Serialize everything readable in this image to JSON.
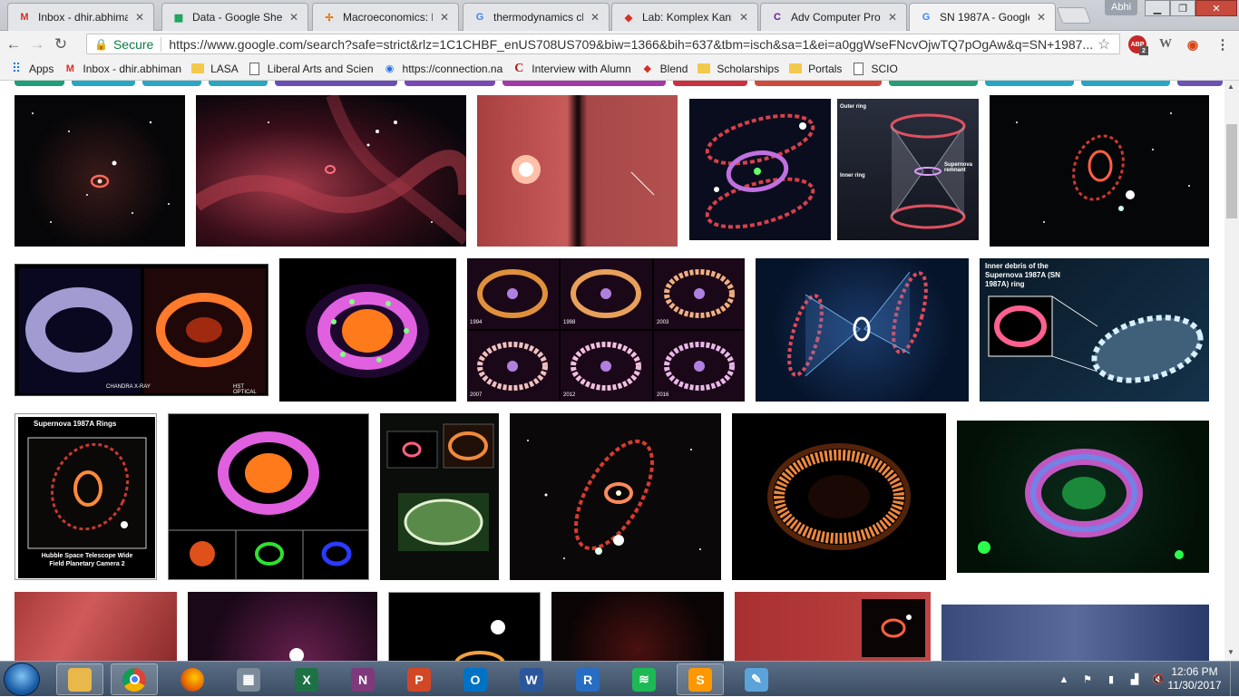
{
  "browser": {
    "tabs": [
      {
        "title": "Inbox - dhir.abhima",
        "icon": "gmail-icon",
        "icon_color": "#d93025",
        "glyph": "M"
      },
      {
        "title": "Data - Google Shee",
        "icon": "sheets-icon",
        "icon_color": "#0f9d58",
        "glyph": "▦"
      },
      {
        "title": "Macroeconomics: P",
        "icon": "pinwheel-icon",
        "icon_color": "#e37400",
        "glyph": "✢"
      },
      {
        "title": "thermodynamics ch",
        "icon": "google-icon",
        "icon_color": "#4285f4",
        "glyph": "G"
      },
      {
        "title": "Lab: Komplex Kanb",
        "icon": "blend-icon",
        "icon_color": "#d93025",
        "glyph": "◆"
      },
      {
        "title": "Adv Computer Prog",
        "icon": "lasa-icon",
        "icon_color": "#6a1b9a",
        "glyph": "C"
      },
      {
        "title": "SN 1987A - Google",
        "icon": "google-icon",
        "icon_color": "#4285f4",
        "glyph": "G"
      }
    ],
    "user_label": "Abhi",
    "secure_label": "Secure",
    "url": "https://www.google.com/search?safe=strict&rlz=1C1CHBF_enUS708US709&biw=1366&bih=637&tbm=isch&sa=1&ei=a0ggWseFNcvOjwTQ7pOgAw&q=SN+1987...",
    "ext_badge": "2"
  },
  "bookmarks": [
    {
      "label": "Apps",
      "icon": "apps-grid-icon"
    },
    {
      "label": "Inbox - dhir.abhiman",
      "icon": "gmail-icon"
    },
    {
      "label": "LASA",
      "icon": "folder-icon"
    },
    {
      "label": "Liberal Arts and Scien",
      "icon": "page-icon"
    },
    {
      "label": "https://connection.na",
      "icon": "globe-icon"
    },
    {
      "label": "Interview with Alumn",
      "icon": "c-logo-icon"
    },
    {
      "label": "Blend",
      "icon": "blend-icon"
    },
    {
      "label": "Scholarships",
      "icon": "folder-icon"
    },
    {
      "label": "Portals",
      "icon": "folder-icon"
    },
    {
      "label": "SCIO",
      "icon": "page-icon"
    }
  ],
  "image_results": [
    {
      "name": "image-result-1",
      "caption": ""
    },
    {
      "name": "image-result-2",
      "caption": ""
    },
    {
      "name": "image-result-3",
      "caption": ""
    },
    {
      "name": "image-result-4",
      "caption": ""
    },
    {
      "name": "image-result-5",
      "caption": ""
    },
    {
      "name": "image-result-6",
      "caption": ""
    },
    {
      "name": "image-result-7",
      "caption": ""
    },
    {
      "name": "image-result-8",
      "caption": ""
    },
    {
      "name": "image-result-9",
      "caption": ""
    },
    {
      "name": "image-result-10",
      "caption": "Inner debris of the Supernova 1987A (SN 1987A) ring"
    },
    {
      "name": "image-result-11",
      "caption": "Supernova 1987A Rings"
    },
    {
      "name": "image-result-12",
      "caption": ""
    },
    {
      "name": "image-result-13",
      "caption": ""
    },
    {
      "name": "image-result-14",
      "caption": ""
    },
    {
      "name": "image-result-15",
      "caption": ""
    },
    {
      "name": "image-result-16",
      "caption": ""
    }
  ],
  "image_text": {
    "thumb4_outer": "Outer ring",
    "thumb4_inner": "Inner ring",
    "thumb4_remnant": "Supernova remnant",
    "thumb6_left": "CHANDRA X-RAY",
    "thumb6_right": "HST OPTICAL",
    "years": [
      "1994",
      "1998",
      "2003",
      "2007",
      "2012",
      "2016"
    ],
    "thumb11_footer": "Hubble Space Telescope Wide Field Planetary Camera 2"
  },
  "taskbar": {
    "apps": [
      {
        "name": "file-explorer-icon",
        "glyph": "",
        "color": "#e8b84a"
      },
      {
        "name": "chrome-icon",
        "glyph": "",
        "color": "#4285f4"
      },
      {
        "name": "firefox-icon",
        "glyph": "",
        "color": "#e66000"
      },
      {
        "name": "calculator-icon",
        "glyph": "▦",
        "color": "#7d8a99"
      },
      {
        "name": "excel-icon",
        "glyph": "X",
        "color": "#1e7145"
      },
      {
        "name": "onenote-icon",
        "glyph": "N",
        "color": "#80397b"
      },
      {
        "name": "powerpoint-icon",
        "glyph": "P",
        "color": "#d24726"
      },
      {
        "name": "outlook-icon",
        "glyph": "O",
        "color": "#0072c6"
      },
      {
        "name": "word-icon",
        "glyph": "W",
        "color": "#2b579a"
      },
      {
        "name": "r-icon",
        "glyph": "R",
        "color": "#276dc3"
      },
      {
        "name": "spotify-icon",
        "glyph": "≋",
        "color": "#1db954"
      },
      {
        "name": "sublime-icon",
        "glyph": "S",
        "color": "#ff9800"
      },
      {
        "name": "paint-icon",
        "glyph": "✎",
        "color": "#5ba3d9"
      }
    ],
    "time": "12:06 PM",
    "date": "11/30/2017"
  }
}
